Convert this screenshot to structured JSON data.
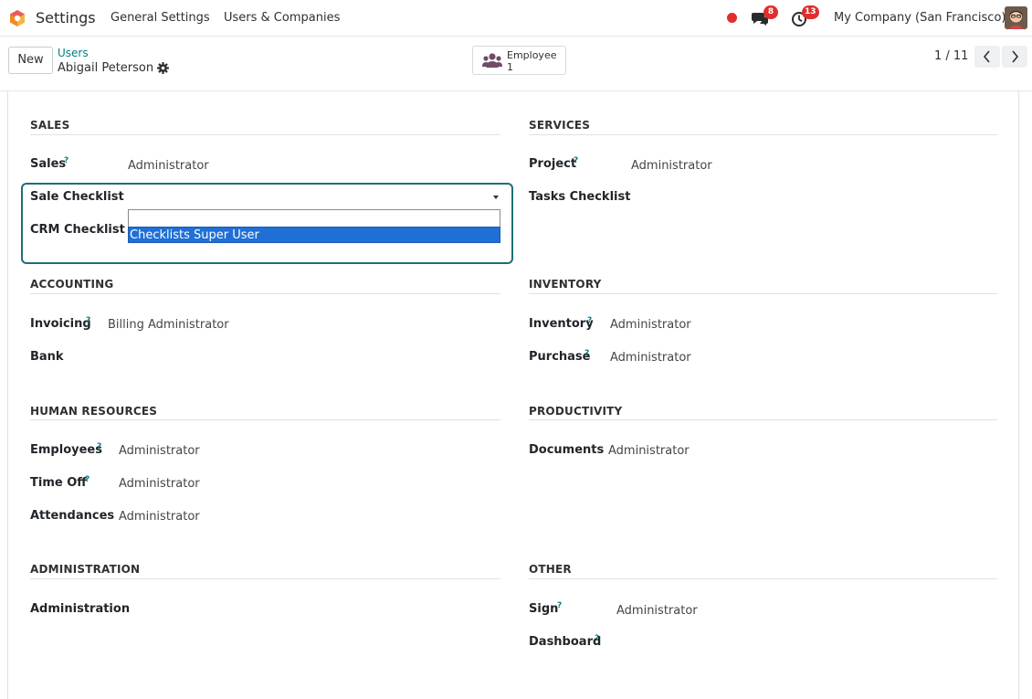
{
  "navbar": {
    "app_title": "Settings",
    "menus": [
      "General Settings",
      "Users & Companies"
    ],
    "messages_count": "8",
    "activities_count": "13",
    "company": "My Company (San Francisco)",
    "accent": "#017e84",
    "alert_color": "#e02d2d"
  },
  "control": {
    "new_label": "New",
    "breadcrumb": "Users",
    "record_name": "Abigail Peterson",
    "smart_button": {
      "label": "Employee",
      "value": "1"
    },
    "pager": "1 / 11"
  },
  "sections": {
    "sales": {
      "title": "SALES",
      "sales_label": "Sales",
      "sales_value": "Administrator",
      "sale_checklist_label": "Sale Checklist",
      "crm_checklist_label": "CRM Checklist"
    },
    "services": {
      "title": "SERVICES",
      "project_label": "Project",
      "project_value": "Administrator",
      "tasks_checklist_label": "Tasks Checklist"
    },
    "accounting": {
      "title": "ACCOUNTING",
      "invoicing_label": "Invoicing",
      "invoicing_value": "Billing Administrator",
      "bank_label": "Bank"
    },
    "inventory": {
      "title": "INVENTORY",
      "inventory_label": "Inventory",
      "inventory_value": "Administrator",
      "purchase_label": "Purchase",
      "purchase_value": "Administrator"
    },
    "hr": {
      "title": "HUMAN RESOURCES",
      "employees_label": "Employees",
      "employees_value": "Administrator",
      "timeoff_label": "Time Off",
      "timeoff_value": "Administrator",
      "attendances_label": "Attendances",
      "attendances_value": "Administrator"
    },
    "productivity": {
      "title": "PRODUCTIVITY",
      "documents_label": "Documents",
      "documents_value": "Administrator"
    },
    "administration": {
      "title": "ADMINISTRATION",
      "administration_label": "Administration"
    },
    "other": {
      "title": "OTHER",
      "sign_label": "Sign",
      "sign_value": "Administrator",
      "dashboard_label": "Dashboard"
    }
  },
  "dropdown": {
    "search_value": "",
    "options": [
      "Checklists Super User"
    ]
  },
  "help_mark": "?"
}
